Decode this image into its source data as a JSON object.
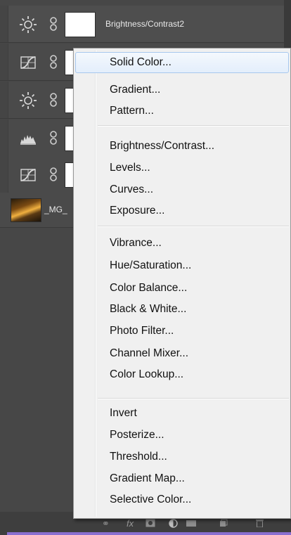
{
  "layers_panel": {
    "layers": [
      {
        "name": "Brightness/Contrast2",
        "icon": "brightness-icon"
      },
      {
        "name": "",
        "icon": "curves-icon"
      },
      {
        "name": "",
        "icon": "brightness-icon"
      },
      {
        "name": "",
        "icon": "levels-icon"
      },
      {
        "name": "",
        "icon": "curves-icon"
      }
    ],
    "photo_layer": {
      "name": "_MG_"
    },
    "footer": {
      "link_glyph": "⚭",
      "fx_label": "fx",
      "icons": [
        "link-icon",
        "fx-icon",
        "add-mask-icon",
        "new-adjustment-icon",
        "new-group-icon",
        "new-layer-icon",
        "delete-icon"
      ]
    }
  },
  "adjustment_menu": {
    "groups": [
      [
        "Solid Color...",
        "Gradient...",
        "Pattern..."
      ],
      [
        "Brightness/Contrast...",
        "Levels...",
        "Curves...",
        "Exposure..."
      ],
      [
        "Vibrance...",
        "Hue/Saturation...",
        "Color Balance...",
        "Black & White...",
        "Photo Filter...",
        "Channel Mixer...",
        "Color Lookup..."
      ],
      [
        "Invert",
        "Posterize...",
        "Threshold...",
        "Gradient Map...",
        "Selective Color..."
      ]
    ],
    "hovered_item": "Solid Color...",
    "colors": {
      "menu_bg": "#f0f0f0",
      "hover_border": "#a8c8ee",
      "panel_bg": "#474747"
    }
  }
}
